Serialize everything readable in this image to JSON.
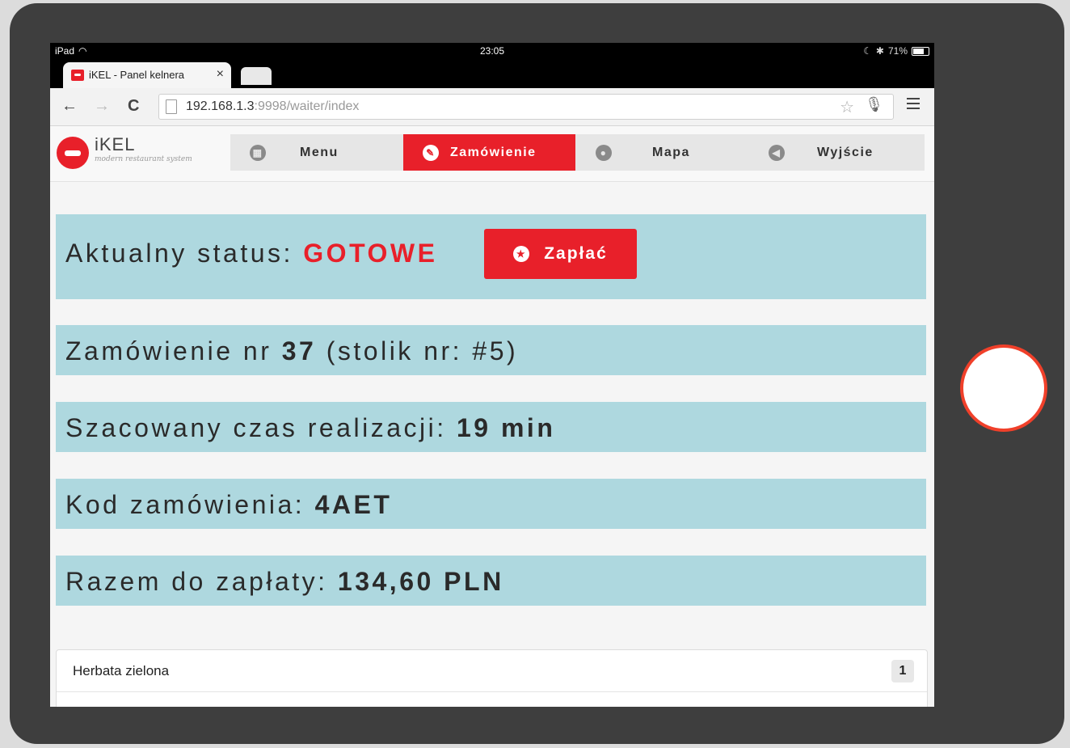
{
  "status_bar": {
    "device": "iPad",
    "time": "23:05",
    "battery": "71%"
  },
  "browser": {
    "tab_title": "iKEL - Panel kelnera",
    "tab_close": "×",
    "url_host": "192.168.1.3",
    "url_rest": ":9998/waiter/index"
  },
  "app": {
    "brand": "iKEL",
    "tagline": "modern restaurant system",
    "nav": [
      {
        "label": "Menu",
        "icon": "grid-globe-icon",
        "glyph": "▦"
      },
      {
        "label": "Zamówienie",
        "icon": "pencil-icon",
        "glyph": "✎"
      },
      {
        "label": "Mapa",
        "icon": "map-pin-icon",
        "glyph": "●"
      },
      {
        "label": "Wyjście",
        "icon": "arrow-left-icon",
        "glyph": "◀"
      }
    ],
    "active_nav": "Zamówienie"
  },
  "order": {
    "status_label": "Aktualny status:",
    "status_value": "GOTOWE",
    "pay_button": "Zapłać",
    "order_prefix": "Zamówienie nr",
    "order_number": "37",
    "table_text": "(stolik nr: #5)",
    "eta_label": "Szacowany czas realizacji:",
    "eta_value": "19 min",
    "code_label": "Kod zamówienia:",
    "code_value": "4AET",
    "total_label": "Razem do zapłaty:",
    "total_value": "134,60 PLN"
  },
  "items": [
    {
      "name": "Herbata zielona",
      "qty": "1"
    }
  ],
  "colors": {
    "accent": "#e8202a",
    "panel": "#aed8df",
    "frame": "#3e3e3e",
    "home_ring": "#f0402a"
  }
}
